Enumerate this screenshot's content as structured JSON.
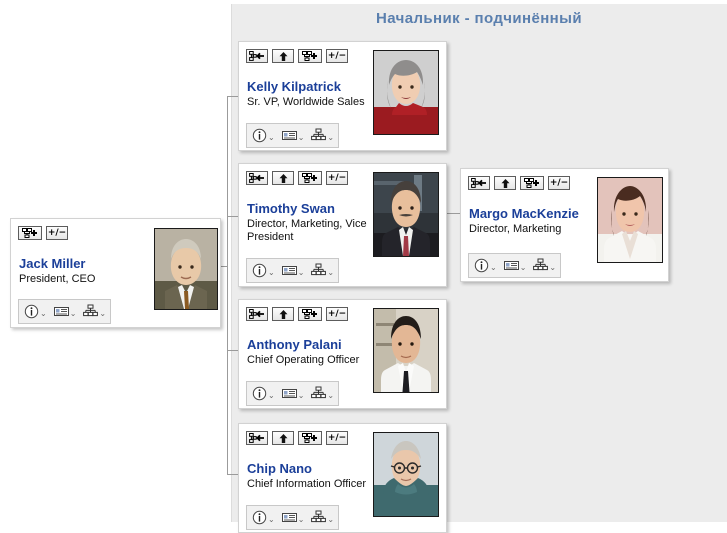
{
  "panel": {
    "title": "Начальник - подчинённый",
    "bg_color": "#ececec",
    "title_color": "#5a7fae"
  },
  "theme": {
    "name_color": "#1b3f99",
    "title_color": "#111111",
    "card_bg": "#ffffff",
    "card_border": "#d2d2d2",
    "connector_color": "#9b9b9b"
  },
  "toolbar_top_buttons": [
    {
      "name": "goto-manager-icon",
      "label": ""
    },
    {
      "name": "move-up-icon",
      "label": ""
    },
    {
      "name": "add-node-icon",
      "label": ""
    },
    {
      "name": "expand-collapse-icon",
      "label": "+/−"
    }
  ],
  "toolbar_bottom_buttons": [
    {
      "name": "info-icon",
      "chevron": "⌄"
    },
    {
      "name": "business-card-icon",
      "chevron": "⌄"
    },
    {
      "name": "org-chart-icon",
      "chevron": "⌄"
    }
  ],
  "cards": [
    {
      "id": "jack-miller",
      "name": "Jack Miller",
      "title": "President, CEO",
      "top_buttons": [
        "add-node-icon",
        "expand-collapse-icon"
      ],
      "photo_alt": "Jack Miller portrait"
    },
    {
      "id": "kelly-kilpatrick",
      "name": "Kelly Kilpatrick",
      "title": "Sr. VP, Worldwide Sales",
      "top_buttons": [
        "goto-manager-icon",
        "move-up-icon",
        "add-node-icon",
        "expand-collapse-icon"
      ],
      "photo_alt": "Kelly Kilpatrick portrait"
    },
    {
      "id": "timothy-swan",
      "name": "Timothy Swan",
      "title": "Director, Marketing, Vice President",
      "top_buttons": [
        "goto-manager-icon",
        "move-up-icon",
        "add-node-icon",
        "expand-collapse-icon"
      ],
      "photo_alt": "Timothy Swan portrait"
    },
    {
      "id": "anthony-palani",
      "name": "Anthony Palani",
      "title": "Chief Operating Officer",
      "top_buttons": [
        "goto-manager-icon",
        "move-up-icon",
        "add-node-icon",
        "expand-collapse-icon"
      ],
      "photo_alt": "Anthony Palani portrait"
    },
    {
      "id": "chip-nano",
      "name": "Chip Nano",
      "title": "Chief Information Officer",
      "top_buttons": [
        "goto-manager-icon",
        "move-up-icon",
        "add-node-icon",
        "expand-collapse-icon"
      ],
      "photo_alt": "Chip Nano portrait"
    },
    {
      "id": "margo-mackenzie",
      "name": "Margo MacKenzie",
      "title": "Director, Marketing",
      "top_buttons": [
        "goto-manager-icon",
        "move-up-icon",
        "add-node-icon",
        "expand-collapse-icon"
      ],
      "photo_alt": "Margo MacKenzie portrait"
    }
  ]
}
